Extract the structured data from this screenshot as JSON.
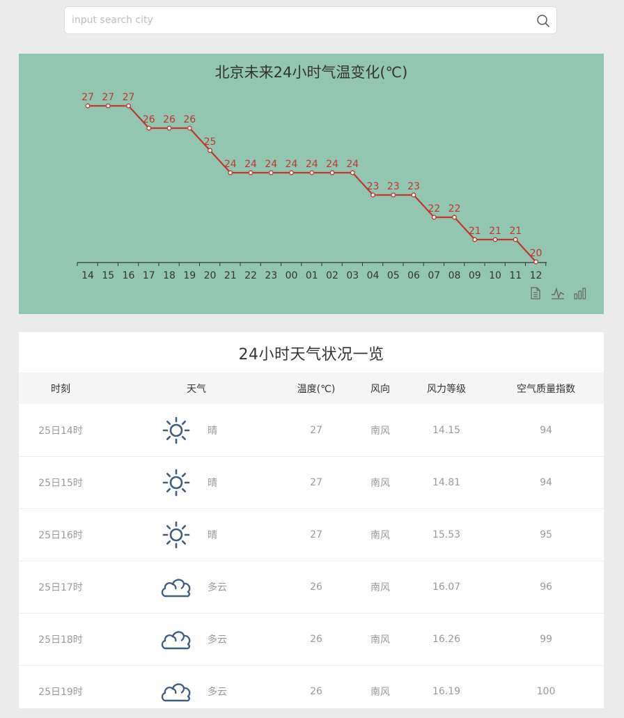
{
  "search": {
    "placeholder": "input search city",
    "value": ""
  },
  "chart_data": {
    "type": "line",
    "title": "北京未来24小时气温变化(℃)",
    "categories": [
      "14",
      "15",
      "16",
      "17",
      "18",
      "19",
      "20",
      "21",
      "22",
      "23",
      "00",
      "01",
      "02",
      "03",
      "04",
      "05",
      "06",
      "07",
      "08",
      "09",
      "10",
      "11",
      "12"
    ],
    "series": [
      {
        "values": [
          27,
          27,
          27,
          26,
          26,
          26,
          25,
          24,
          24,
          24,
          24,
          24,
          24,
          24,
          23,
          23,
          23,
          22,
          22,
          21,
          21,
          21,
          20
        ]
      }
    ],
    "line_style": "step",
    "ylim": [
      20,
      27
    ],
    "grid": false,
    "colors": {
      "line": "#c23531",
      "background": "#92c6b0",
      "axis": "#333333"
    }
  },
  "toolbox": [
    "data-view-icon",
    "line-chart-icon",
    "bar-chart-icon"
  ],
  "table": {
    "title": "24小时天气状况一览",
    "headers": [
      "时刻",
      "天气",
      "温度(℃)",
      "风向",
      "风力等级",
      "空气质量指数"
    ],
    "rows": [
      {
        "time": "25日14时",
        "icon": "sun-icon",
        "weather": "晴",
        "temp": "27",
        "wind_dir": "南风",
        "wind_level": "14.15",
        "aqi": "94"
      },
      {
        "time": "25日15时",
        "icon": "sun-icon",
        "weather": "晴",
        "temp": "27",
        "wind_dir": "南风",
        "wind_level": "14.81",
        "aqi": "94"
      },
      {
        "time": "25日16时",
        "icon": "sun-icon",
        "weather": "晴",
        "temp": "27",
        "wind_dir": "南风",
        "wind_level": "15.53",
        "aqi": "95"
      },
      {
        "time": "25日17时",
        "icon": "cloud-icon",
        "weather": "多云",
        "temp": "26",
        "wind_dir": "南风",
        "wind_level": "16.07",
        "aqi": "96"
      },
      {
        "time": "25日18时",
        "icon": "cloud-icon",
        "weather": "多云",
        "temp": "26",
        "wind_dir": "南风",
        "wind_level": "16.26",
        "aqi": "99"
      },
      {
        "time": "25日19时",
        "icon": "cloud-icon",
        "weather": "多云",
        "temp": "26",
        "wind_dir": "南风",
        "wind_level": "16.19",
        "aqi": "100"
      }
    ]
  },
  "colors": {
    "icon": "#3e5d7e",
    "page_bg": "#ebebeb"
  }
}
